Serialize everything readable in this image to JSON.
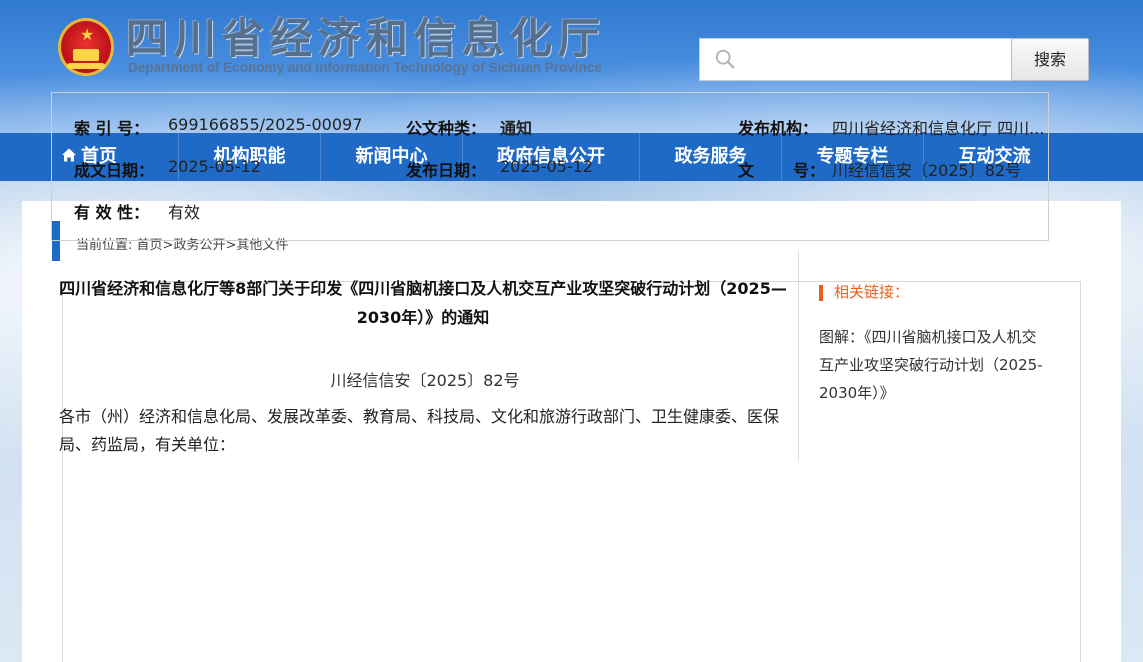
{
  "header": {
    "title": "四川省经济和信息化厅",
    "subtitle": "Department of Economy and Information Technology of Sichuan Province",
    "emblem_icon": "national-emblem-icon",
    "search": {
      "placeholder": "",
      "button_label": "搜索"
    }
  },
  "nav": {
    "items": [
      {
        "label": "首页",
        "icon": "home-icon"
      },
      {
        "label": "机构职能"
      },
      {
        "label": "新闻中心"
      },
      {
        "label": "政府信息公开"
      },
      {
        "label": "政务服务"
      },
      {
        "label": "专题专栏"
      },
      {
        "label": "互动交流"
      }
    ]
  },
  "breadcrumb": {
    "prefix": "当前位置:",
    "items": [
      "首页",
      "政务公开",
      "其他文件"
    ],
    "separator": ">"
  },
  "meta": {
    "index_label": "索 引 号：",
    "index_value": "699166855/2025-00097",
    "category_label": "公文种类：",
    "category_value": "通知",
    "publisher_label": "发布机构：",
    "publisher_value": "四川省经济和信息化厅 四川...",
    "created_label": "成文日期：",
    "created_value": "2025-05-12",
    "published_label": "发布日期：",
    "published_value": "2025-05-12",
    "docno_label": "文       号：",
    "docno_value": "川经信信安〔2025〕82号",
    "validity_label": "有 效 性：",
    "validity_value": "有效"
  },
  "article": {
    "title": "四川省经济和信息化厅等8部门关于印发《四川省脑机接口及人机交互产业攻坚突破行动计划（2025—2030年）》的通知",
    "doc_number": "川经信信安〔2025〕82号",
    "addressees": "各市（州）经济和信息化局、发展改革委、教育局、科技局、文化和旅游行政部门、卫生健康委、医保局、药监局，有关单位："
  },
  "sidebar": {
    "title": "相关链接：",
    "link": "图解：《四川省脑机接口及人机交互产业攻坚突破行动计划（2025-2030年）》"
  },
  "colors": {
    "nav_bg": "#1f69c7",
    "accent_orange": "#e8601c",
    "banner_blue": "#2f78d0"
  }
}
